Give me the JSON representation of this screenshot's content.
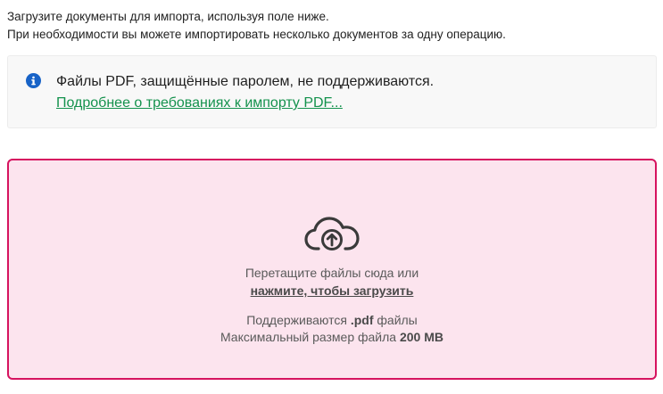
{
  "intro": {
    "line1": "Загрузите документы для импорта, используя поле ниже.",
    "line2": "При необходимости вы можете импортировать несколько документов за одну операцию."
  },
  "notice": {
    "icon": "info-icon",
    "text": "Файлы PDF, защищённые паролем, не поддерживаются.",
    "link": "Подробнее о требованиях к импорту PDF..."
  },
  "dropzone": {
    "icon": "cloud-upload-icon",
    "drag_text": "Перетащите файлы сюда или",
    "click_text": "нажмите, чтобы загрузить",
    "supported_prefix": "Поддерживаются ",
    "supported_ext": ".pdf",
    "supported_suffix": " файлы",
    "max_prefix": "Максимальный размер файла ",
    "max_value": "200 MB"
  },
  "colors": {
    "info": "#1863c7",
    "link": "#14924d",
    "dropzone_border": "#d6135f",
    "dropzone_bg": "#fce4ee"
  }
}
